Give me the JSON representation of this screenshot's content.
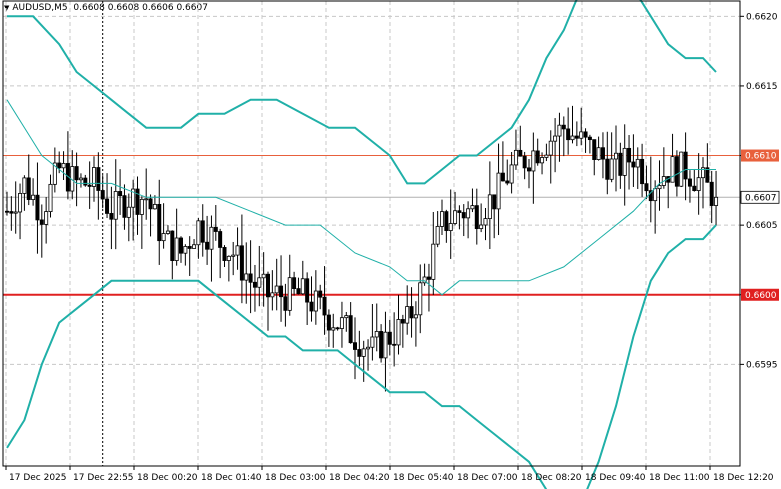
{
  "header": {
    "symbol": "AUDUSD,M5",
    "ohlc": "0.6608 0.6608 0.6606 0.6607"
  },
  "chart_data": {
    "type": "candlestick",
    "symbol": "AUDUSD",
    "timeframe": "M5",
    "ylim": [
      0.65877,
      0.66211
    ],
    "y_ticks": [
      "0.6620",
      "0.6615",
      "0.6610",
      "0.6605",
      "0.6600",
      "0.6595"
    ],
    "x_ticks": [
      "17 Dec 2025",
      "17 Dec 22:55",
      "18 Dec 00:20",
      "18 Dec 01:40",
      "18 Dec 03:00",
      "18 Dec 04:20",
      "18 Dec 05:40",
      "18 Dec 07:00",
      "18 Dec 08:20",
      "18 Dec 09:40",
      "18 Dec 11:00",
      "18 Dec 12:20"
    ],
    "grid": true,
    "horizontal_lines": [
      {
        "value": 0.661,
        "label": "0.6610",
        "color": "#e8603c",
        "width": 1
      },
      {
        "value": 0.66,
        "label": "0.6600",
        "color": "#e02020",
        "width": 2
      }
    ],
    "current_price": {
      "value": 0.6607,
      "label": "0.6607",
      "color": "#b0b0b0"
    },
    "vertical_marker_index": 22,
    "close_path": [
      [
        0,
        0.6606
      ],
      [
        4,
        0.6608
      ],
      [
        8,
        0.6606
      ],
      [
        12,
        0.6609
      ],
      [
        16,
        0.6608
      ],
      [
        20,
        0.6608
      ],
      [
        24,
        0.6606
      ],
      [
        28,
        0.6607
      ],
      [
        32,
        0.6607
      ],
      [
        36,
        0.6604
      ],
      [
        40,
        0.6603
      ],
      [
        44,
        0.6605
      ],
      [
        48,
        0.6604
      ],
      [
        52,
        0.6603
      ],
      [
        56,
        0.6601
      ],
      [
        60,
        0.66
      ],
      [
        64,
        0.66
      ],
      [
        68,
        0.66
      ],
      [
        72,
        0.6599
      ],
      [
        76,
        0.6598
      ],
      [
        80,
        0.6597
      ],
      [
        84,
        0.6596
      ],
      [
        88,
        0.6597
      ],
      [
        92,
        0.6598
      ],
      [
        96,
        0.6601
      ],
      [
        100,
        0.6605
      ],
      [
        104,
        0.6606
      ],
      [
        108,
        0.6606
      ],
      [
        112,
        0.6607
      ],
      [
        116,
        0.6609
      ],
      [
        120,
        0.661
      ],
      [
        124,
        0.6611
      ],
      [
        128,
        0.6612
      ],
      [
        132,
        0.6611
      ],
      [
        136,
        0.661
      ],
      [
        140,
        0.6609
      ],
      [
        144,
        0.661
      ],
      [
        148,
        0.6608
      ],
      [
        152,
        0.6609
      ],
      [
        156,
        0.6609
      ],
      [
        160,
        0.6608
      ],
      [
        163,
        0.6607
      ]
    ],
    "series": [
      {
        "name": "",
        "type": "line",
        "color": "#20b0a8",
        "width": 2,
        "points": [
          [
            0,
            0.662
          ],
          [
            6,
            0.662
          ],
          [
            12,
            0.6618
          ],
          [
            16,
            0.6616
          ],
          [
            20,
            0.6615
          ],
          [
            24,
            0.6614
          ],
          [
            28,
            0.6613
          ],
          [
            32,
            0.6612
          ],
          [
            36,
            0.6612
          ],
          [
            40,
            0.6612
          ],
          [
            44,
            0.6613
          ],
          [
            50,
            0.6613
          ],
          [
            56,
            0.6614
          ],
          [
            62,
            0.6614
          ],
          [
            68,
            0.6613
          ],
          [
            74,
            0.6612
          ],
          [
            80,
            0.6612
          ],
          [
            84,
            0.6611
          ],
          [
            88,
            0.661
          ],
          [
            92,
            0.6608
          ],
          [
            96,
            0.6608
          ],
          [
            100,
            0.6609
          ],
          [
            104,
            0.661
          ],
          [
            108,
            0.661
          ],
          [
            112,
            0.6611
          ],
          [
            116,
            0.6612
          ],
          [
            120,
            0.6614
          ],
          [
            124,
            0.6617
          ],
          [
            128,
            0.6619
          ],
          [
            132,
            0.6622
          ],
          [
            136,
            0.6623
          ],
          [
            140,
            0.6624
          ],
          [
            144,
            0.6622
          ],
          [
            148,
            0.662
          ],
          [
            152,
            0.6618
          ],
          [
            156,
            0.6617
          ],
          [
            160,
            0.6617
          ],
          [
            163,
            0.6616
          ]
        ]
      },
      {
        "name": "",
        "type": "line",
        "color": "#20b0a8",
        "width": 2,
        "points": [
          [
            0,
            0.6589
          ],
          [
            4,
            0.6591
          ],
          [
            8,
            0.6595
          ],
          [
            12,
            0.6598
          ],
          [
            16,
            0.6599
          ],
          [
            20,
            0.66
          ],
          [
            24,
            0.6601
          ],
          [
            28,
            0.6601
          ],
          [
            32,
            0.6601
          ],
          [
            36,
            0.6601
          ],
          [
            40,
            0.6601
          ],
          [
            44,
            0.6601
          ],
          [
            48,
            0.66
          ],
          [
            52,
            0.6599
          ],
          [
            56,
            0.6598
          ],
          [
            60,
            0.6597
          ],
          [
            64,
            0.6597
          ],
          [
            68,
            0.6596
          ],
          [
            72,
            0.6596
          ],
          [
            76,
            0.6596
          ],
          [
            80,
            0.6595
          ],
          [
            84,
            0.6594
          ],
          [
            88,
            0.6593
          ],
          [
            92,
            0.6593
          ],
          [
            96,
            0.6593
          ],
          [
            100,
            0.6592
          ],
          [
            104,
            0.6592
          ],
          [
            108,
            0.6591
          ],
          [
            112,
            0.659
          ],
          [
            116,
            0.6589
          ],
          [
            120,
            0.6588
          ],
          [
            124,
            0.6586
          ],
          [
            128,
            0.6585
          ],
          [
            132,
            0.6585
          ],
          [
            136,
            0.6588
          ],
          [
            140,
            0.6592
          ],
          [
            144,
            0.6597
          ],
          [
            148,
            0.6601
          ],
          [
            152,
            0.6603
          ],
          [
            156,
            0.6604
          ],
          [
            160,
            0.6604
          ],
          [
            163,
            0.6605
          ]
        ]
      },
      {
        "name": "",
        "type": "line",
        "color": "#20b0a8",
        "width": 1,
        "points": [
          [
            0,
            0.6614
          ],
          [
            8,
            0.661
          ],
          [
            16,
            0.6608
          ],
          [
            24,
            0.6608
          ],
          [
            32,
            0.6607
          ],
          [
            40,
            0.6607
          ],
          [
            48,
            0.6607
          ],
          [
            56,
            0.6606
          ],
          [
            64,
            0.6605
          ],
          [
            72,
            0.6605
          ],
          [
            80,
            0.6603
          ],
          [
            88,
            0.6602
          ],
          [
            92,
            0.6601
          ],
          [
            96,
            0.6601
          ],
          [
            100,
            0.66
          ],
          [
            104,
            0.6601
          ],
          [
            112,
            0.6601
          ],
          [
            120,
            0.6601
          ],
          [
            128,
            0.6602
          ],
          [
            136,
            0.6604
          ],
          [
            144,
            0.6606
          ],
          [
            150,
            0.6608
          ],
          [
            156,
            0.6609
          ],
          [
            160,
            0.6609
          ],
          [
            163,
            0.6609
          ]
        ]
      }
    ]
  }
}
